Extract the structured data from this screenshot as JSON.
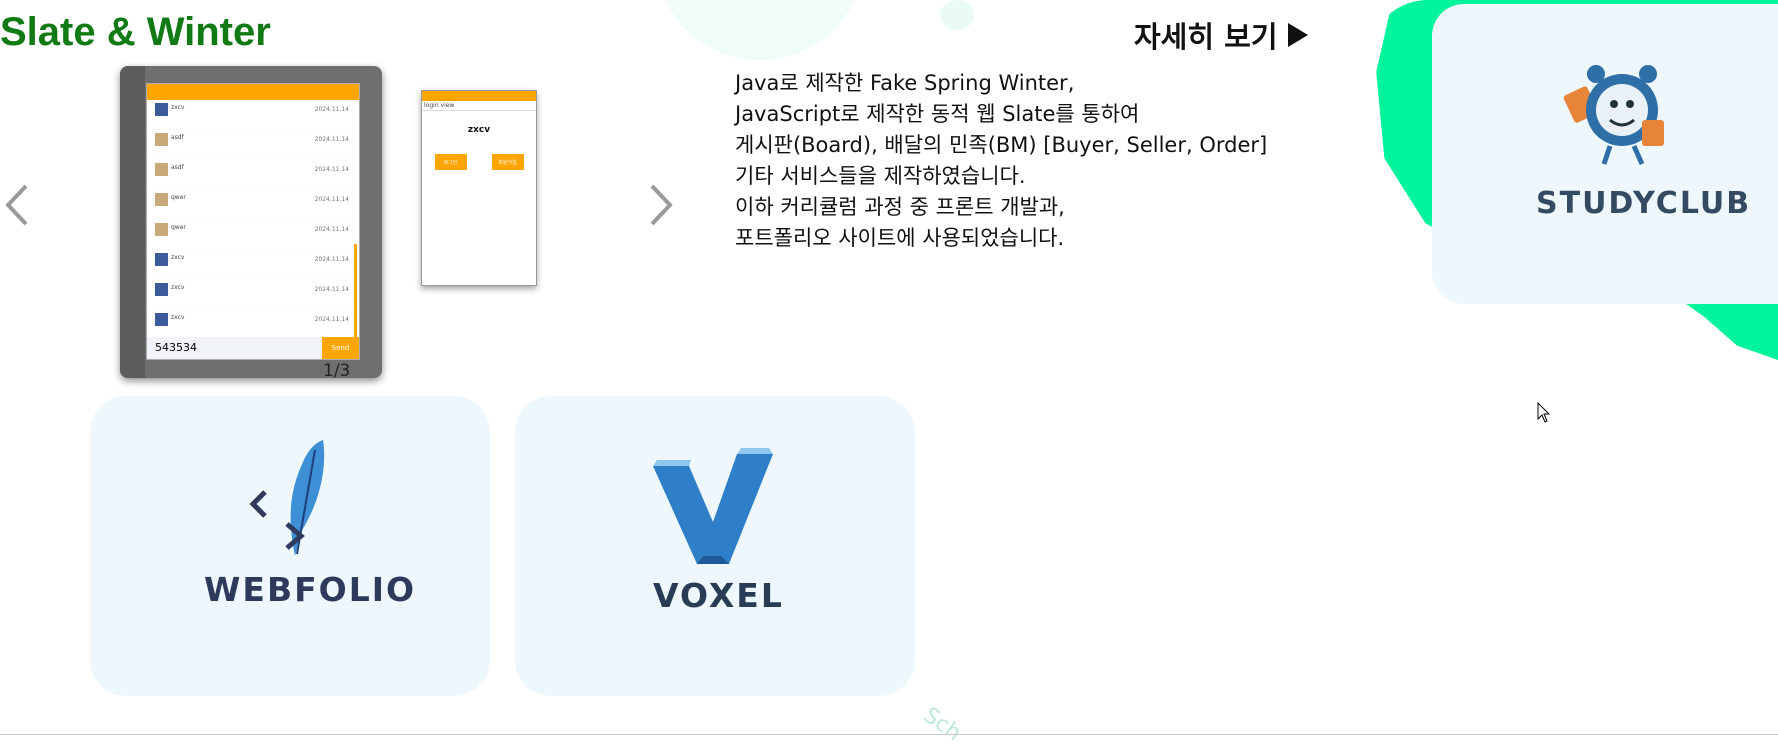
{
  "header": {
    "title": "Slate & Winter",
    "detail_link": "자세히 보기"
  },
  "carousel": {
    "counter": "1/3",
    "slide1": {
      "rows": [
        {
          "name": "zxcv",
          "date": "2024.11.14"
        },
        {
          "name": "asdf",
          "date": "2024.11.14"
        },
        {
          "name": "asdf",
          "date": "2024.11.14"
        },
        {
          "name": "qwer",
          "date": "2024.11.14"
        },
        {
          "name": "qwer",
          "date": "2024.11.14"
        },
        {
          "name": "zxcv",
          "date": "2024.11.14"
        },
        {
          "name": "zxcv",
          "date": "2024.11.14"
        },
        {
          "name": "zxcv",
          "date": "2024.11.14"
        }
      ],
      "input_value": "543534",
      "send_label": "Send"
    },
    "slide2": {
      "subtitle": "login view",
      "name": "zxcv",
      "btn1": "로그인",
      "btn2": "회원가입"
    }
  },
  "description": {
    "lines": [
      "Java로 제작한 Fake Spring Winter,",
      "JavaScript로 제작한 동적 웹 Slate를 통하여",
      "게시판(Board), 배달의 민족(BM) [Buyer, Seller, Order]",
      "기타 서비스들을 제작하였습니다.",
      "이하 커리큘럼 과정 중 프론트 개발과,",
      "포트폴리오 사이트에 사용되었습니다."
    ]
  },
  "cards": {
    "studyclub": "STUDYCLUB",
    "webfolio": "WEBFOLIO",
    "voxel": "VOXEL"
  },
  "footer": {
    "partial_text": "Sch"
  },
  "colors": {
    "title_green": "#117a14",
    "accent_orange": "#ffa500",
    "mint": "#00f49b",
    "card_bg": "#eef7fb"
  }
}
